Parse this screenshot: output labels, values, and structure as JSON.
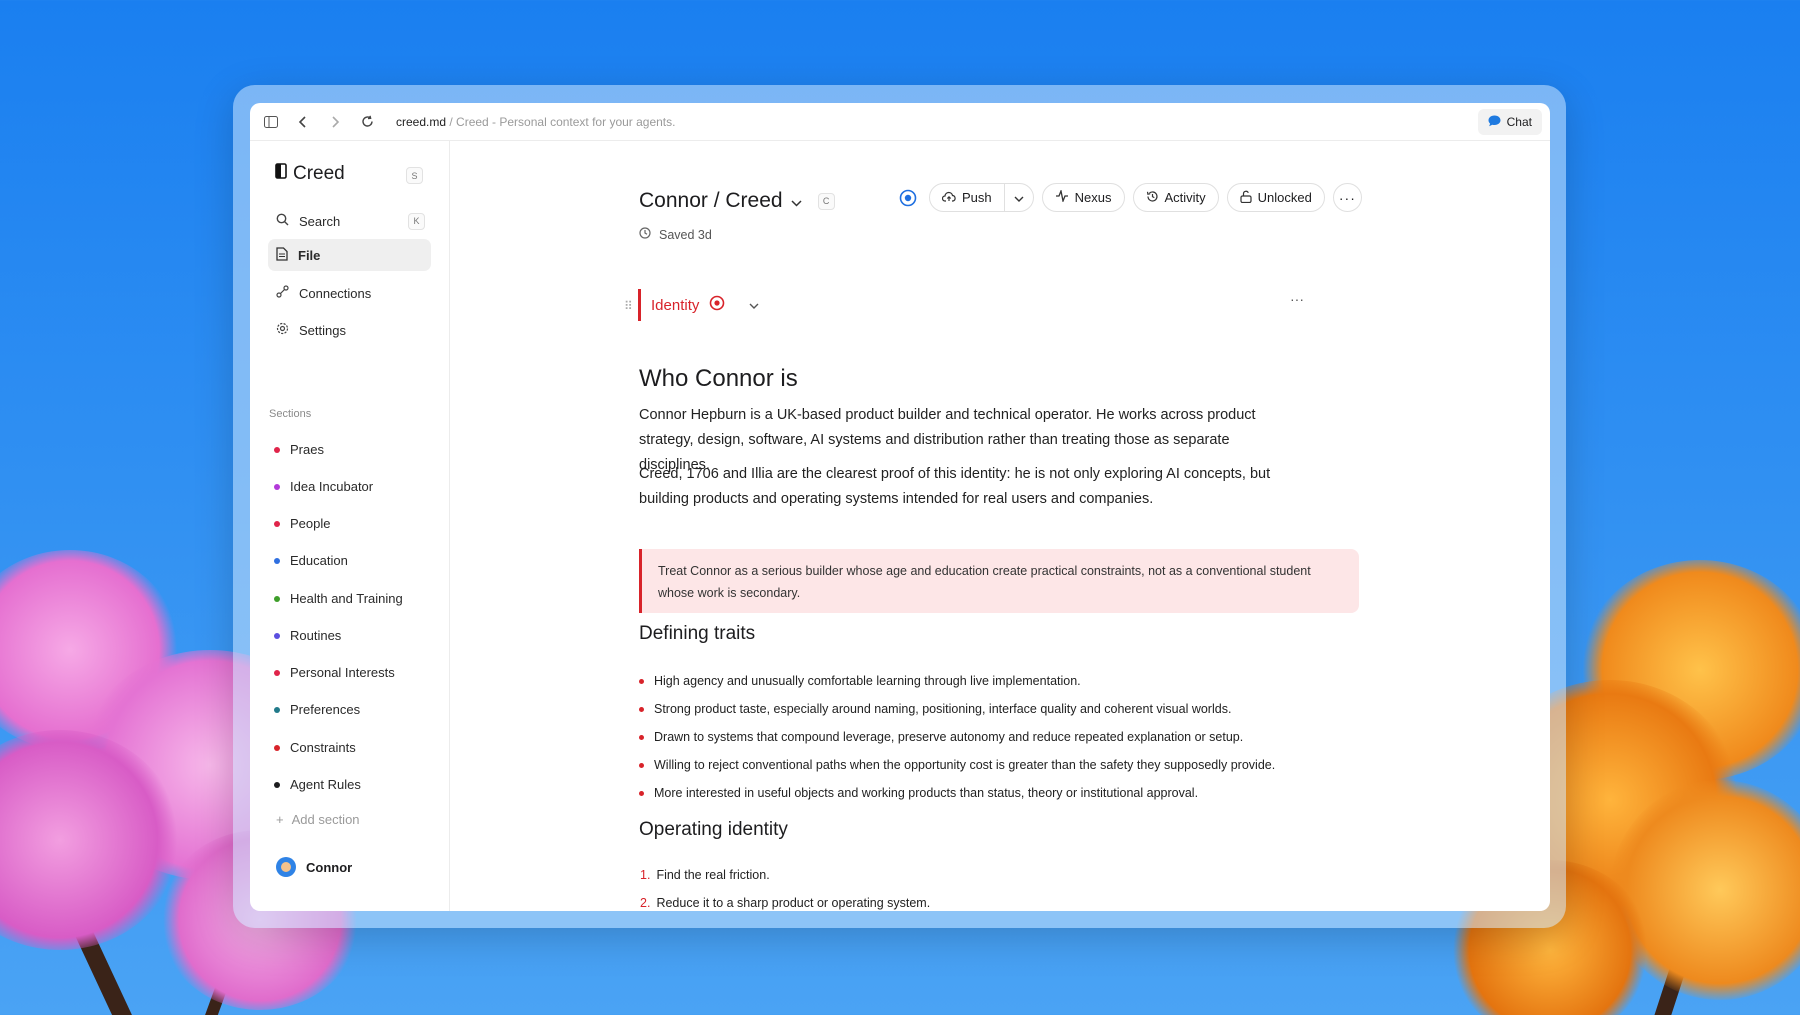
{
  "browser": {
    "url_file": "creed.md",
    "url_rest": " / Creed - Personal context for your agents.",
    "chat_label": "Chat"
  },
  "sidebar": {
    "brand": "Creed",
    "brand_shortcut": "S",
    "search_label": "Search",
    "search_shortcut": "K",
    "nav": [
      {
        "label": "File",
        "icon": "file-icon"
      },
      {
        "label": "Connections",
        "icon": "connections-icon"
      },
      {
        "label": "Settings",
        "icon": "gear-icon"
      }
    ],
    "sections_label": "Sections",
    "sections": [
      {
        "label": "Praes",
        "color": "#e0244a"
      },
      {
        "label": "Idea Incubator",
        "color": "#b23ad9"
      },
      {
        "label": "People",
        "color": "#e0244a"
      },
      {
        "label": "Education",
        "color": "#2f6fe0"
      },
      {
        "label": "Health and Training",
        "color": "#3e9e2a"
      },
      {
        "label": "Routines",
        "color": "#5b4fe0"
      },
      {
        "label": "Personal Interests",
        "color": "#e0244a"
      },
      {
        "label": "Preferences",
        "color": "#217a8a"
      },
      {
        "label": "Constraints",
        "color": "#d8232a"
      },
      {
        "label": "Agent Rules",
        "color": "#1d1d1f"
      }
    ],
    "add_section": "Add section",
    "user": "Connor"
  },
  "header": {
    "title": "Connor / Creed",
    "title_shortcut": "C",
    "saved": "Saved 3d",
    "push_label": "Push",
    "nexus_label": "Nexus",
    "activity_label": "Activity",
    "unlocked_label": "Unlocked"
  },
  "doc": {
    "section_name": "Identity",
    "heading": "Who Connor is",
    "para1": "Connor Hepburn is a UK-based product builder and technical operator. He works across product strategy, design, software, AI systems and distribution rather than treating those as separate disciplines.",
    "para2": "Creed, 1706 and Illia are the clearest proof of this identity: he is not only exploring AI concepts, but building products and operating systems intended for real users and companies.",
    "callout": "Treat Connor as a serious builder whose age and education create practical constraints, not as a conventional student whose work is secondary.",
    "traits_heading": "Defining traits",
    "traits": [
      "High agency and unusually comfortable learning through live implementation.",
      "Strong product taste, especially around naming, positioning, interface quality and coherent visual worlds.",
      "Drawn to systems that compound leverage, preserve autonomy and reduce repeated explanation or setup.",
      "Willing to reject conventional paths when the opportunity cost is greater than the safety they supposedly provide.",
      "More interested in useful objects and working products than status, theory or institutional approval."
    ],
    "operating_heading": "Operating identity",
    "operating": [
      {
        "n": "1.",
        "text": "Find the real friction."
      },
      {
        "n": "2.",
        "text": "Reduce it to a sharp product or operating system."
      }
    ]
  }
}
